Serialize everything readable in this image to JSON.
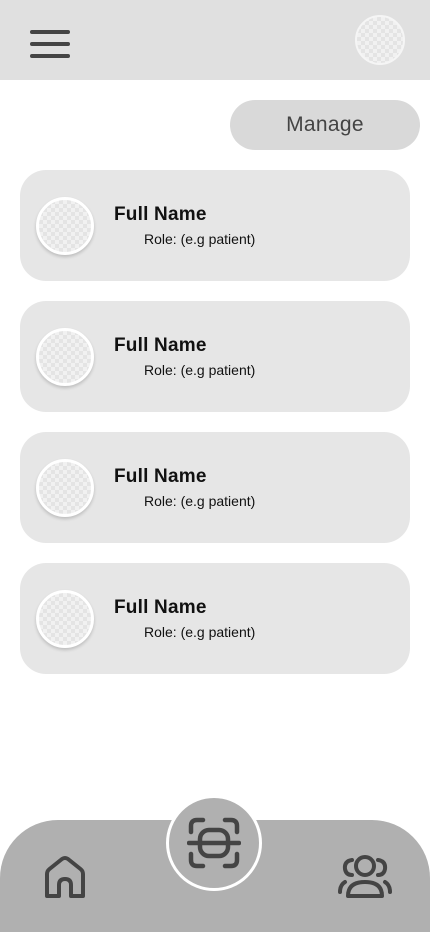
{
  "header": {
    "menu_icon": "hamburger-menu-icon",
    "profile_icon": "avatar-placeholder"
  },
  "actions": {
    "manage_label": "Manage"
  },
  "users": [
    {
      "name": "Full Name",
      "role": "Role: (e.g patient)"
    },
    {
      "name": "Full Name",
      "role": "Role: (e.g patient)"
    },
    {
      "name": "Full Name",
      "role": "Role: (e.g patient)"
    },
    {
      "name": "Full Name",
      "role": "Role: (e.g patient)"
    }
  ],
  "bottom_nav": {
    "items": [
      {
        "icon": "home-icon"
      },
      {
        "icon": "scan-icon"
      },
      {
        "icon": "users-icon"
      }
    ]
  },
  "colors": {
    "header_bg": "#e0e0e0",
    "card_bg": "#e6e6e6",
    "button_bg": "#d9d9d9",
    "nav_bg": "#b0b0b0",
    "icon": "#444444"
  }
}
